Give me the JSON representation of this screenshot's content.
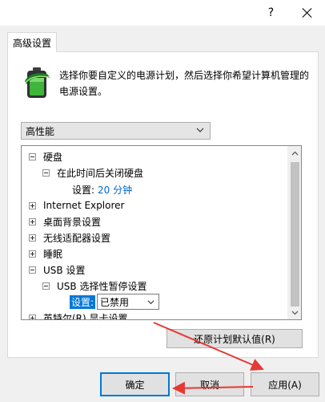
{
  "window": {
    "help_label": "?",
    "close_icon": "close-icon"
  },
  "tab": {
    "label": "高级设置"
  },
  "description": "选择你要自定义的电源计划，然后选择你希望计算机管理的电源设置。",
  "plan_select": {
    "value": "高性能"
  },
  "tree": {
    "items": {
      "hard_disk": "硬盘",
      "turn_off_disk": "在此时间后关闭硬盘",
      "disk_setting_label": "设置:",
      "disk_setting_value": "20 分钟",
      "ie": "Internet Explorer",
      "desktop_bg": "桌面背景设置",
      "wireless": "无线适配器设置",
      "sleep": "睡眠",
      "usb": "USB 设置",
      "usb_suspend": "USB 选择性暂停设置",
      "usb_setting_label": "设置:",
      "usb_setting_value": "已禁用",
      "intel_graphics": "英特尔(R) 显卡设置"
    }
  },
  "buttons": {
    "restore": "还原计划默认值(R)",
    "ok": "确定",
    "cancel": "取消",
    "apply": "应用(A)"
  },
  "colors": {
    "accent": "#0078d7",
    "value_blue": "#0066cc",
    "annotation_red": "#e53935"
  }
}
